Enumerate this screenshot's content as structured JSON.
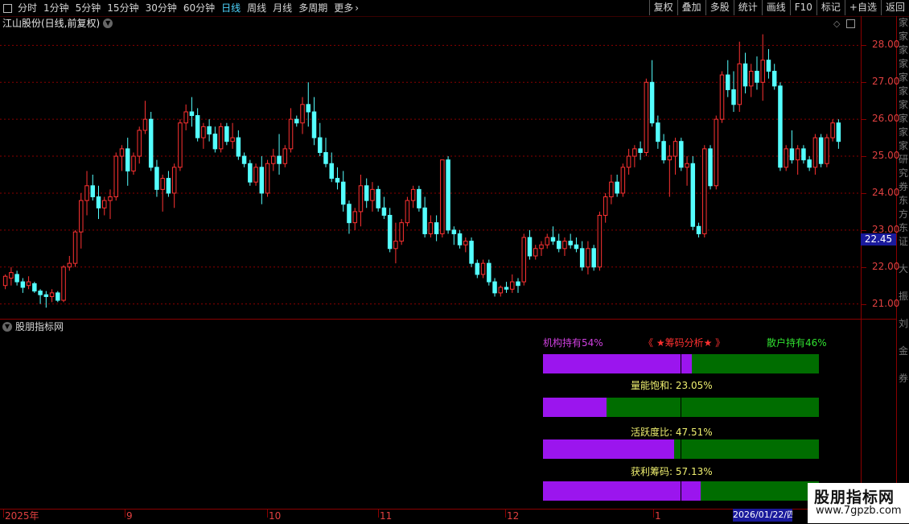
{
  "toolbar": {
    "period_tabs": [
      "分时",
      "1分钟",
      "5分钟",
      "15分钟",
      "30分钟",
      "60分钟",
      "日线",
      "周线",
      "月线",
      "多周期",
      "更多"
    ],
    "active_tab": "日线",
    "right_buttons": [
      "复权",
      "叠加",
      "多股",
      "统计",
      "画线",
      "F10",
      "标记",
      "+自选",
      "返回"
    ]
  },
  "main_panel": {
    "title": "江山股份(日线,前复权)",
    "current_price_label": "22.45",
    "price_axis_labels": [
      "28.00",
      "27.00",
      "26.00",
      "25.00",
      "24.00",
      "23.00",
      "22.00",
      "21.00"
    ]
  },
  "sub_panel": {
    "title": "股朋指标网",
    "header_left": "机构持有54%",
    "header_center": "《 ★筹码分析★ 》",
    "header_right": "散户持有46%",
    "rows": [
      {
        "label": "",
        "fraction": 0.54
      },
      {
        "label": "量能饱和:  23.05%",
        "fraction": 0.2305
      },
      {
        "label": "活跃度比:  47.51%",
        "fraction": 0.4751
      },
      {
        "label": "获利筹码:  57.13%",
        "fraction": 0.5713
      }
    ]
  },
  "date_axis": {
    "labels": [
      "2025年",
      "9",
      "10",
      "11",
      "12",
      "1"
    ],
    "cursor_date": "2026/01/22/四"
  },
  "right_strip_text": "家家家家家家家家家家研究券东方东证 大 振 刘 金 券",
  "watermark": {
    "line1": "股朋指标网",
    "line2": "www.7gpzb.com"
  },
  "colors": {
    "up": "#ff3232",
    "down": "#54ffff",
    "grid": "#8a0000",
    "purple": "#9b15ee",
    "green": "#006d00"
  },
  "chart_data": {
    "type": "candlestick",
    "ylim": [
      20.6,
      28.4
    ],
    "ohlc": [
      [
        21.5,
        21.8,
        21.4,
        21.75
      ],
      [
        21.7,
        22.0,
        21.5,
        21.85
      ],
      [
        21.8,
        21.9,
        21.5,
        21.6
      ],
      [
        21.6,
        21.7,
        21.3,
        21.45
      ],
      [
        21.5,
        21.75,
        21.4,
        21.6
      ],
      [
        21.55,
        21.6,
        21.3,
        21.35
      ],
      [
        21.35,
        21.4,
        21.0,
        21.25
      ],
      [
        21.25,
        21.35,
        20.9,
        21.2
      ],
      [
        21.2,
        21.4,
        21.05,
        21.3
      ],
      [
        21.3,
        21.35,
        21.05,
        21.1
      ],
      [
        21.1,
        22.05,
        21.05,
        22.0
      ],
      [
        22.0,
        22.3,
        21.9,
        22.1
      ],
      [
        22.1,
        23.0,
        22.0,
        22.95
      ],
      [
        22.95,
        24.0,
        22.5,
        23.8
      ],
      [
        23.8,
        24.6,
        23.4,
        24.2
      ],
      [
        24.2,
        24.5,
        23.8,
        23.9
      ],
      [
        23.9,
        24.2,
        23.3,
        23.6
      ],
      [
        23.6,
        23.9,
        23.4,
        23.8
      ],
      [
        23.8,
        24.1,
        23.3,
        23.9
      ],
      [
        23.9,
        25.1,
        23.8,
        25.0
      ],
      [
        25.0,
        25.3,
        24.6,
        25.2
      ],
      [
        25.2,
        25.5,
        24.2,
        24.6
      ],
      [
        24.6,
        25.1,
        24.5,
        25.0
      ],
      [
        25.0,
        25.8,
        24.8,
        25.7
      ],
      [
        25.7,
        26.5,
        25.6,
        26.0
      ],
      [
        26.0,
        26.2,
        24.6,
        24.7
      ],
      [
        24.7,
        24.9,
        23.9,
        24.1
      ],
      [
        24.1,
        24.5,
        23.5,
        24.4
      ],
      [
        24.4,
        24.6,
        23.9,
        24.0
      ],
      [
        24.0,
        24.8,
        23.6,
        24.7
      ],
      [
        24.7,
        26.0,
        24.6,
        25.9
      ],
      [
        25.9,
        26.4,
        25.7,
        26.2
      ],
      [
        26.2,
        26.6,
        25.8,
        26.1
      ],
      [
        26.1,
        26.3,
        25.4,
        25.5
      ],
      [
        25.5,
        25.9,
        25.2,
        25.8
      ],
      [
        25.8,
        26.0,
        25.4,
        25.6
      ],
      [
        25.6,
        25.8,
        25.1,
        25.2
      ],
      [
        25.2,
        25.9,
        25.1,
        25.8
      ],
      [
        25.8,
        25.9,
        25.3,
        25.4
      ],
      [
        25.4,
        25.9,
        25.2,
        25.5
      ],
      [
        25.5,
        25.7,
        24.9,
        25.0
      ],
      [
        25.0,
        25.1,
        24.7,
        24.8
      ],
      [
        24.8,
        24.9,
        24.2,
        24.3
      ],
      [
        24.3,
        24.8,
        24.2,
        24.7
      ],
      [
        24.7,
        25.0,
        23.7,
        24.0
      ],
      [
        24.0,
        24.9,
        23.9,
        24.8
      ],
      [
        24.8,
        25.2,
        24.6,
        25.0
      ],
      [
        25.0,
        25.6,
        24.5,
        24.8
      ],
      [
        24.8,
        25.3,
        24.7,
        25.2
      ],
      [
        25.2,
        26.3,
        25.1,
        26.0
      ],
      [
        26.0,
        26.1,
        25.8,
        25.9
      ],
      [
        25.9,
        26.6,
        25.6,
        26.4
      ],
      [
        26.4,
        27.0,
        25.8,
        26.2
      ],
      [
        26.2,
        26.6,
        25.3,
        25.5
      ],
      [
        25.5,
        25.9,
        25.0,
        25.1
      ],
      [
        25.1,
        25.5,
        24.7,
        24.8
      ],
      [
        24.8,
        25.1,
        24.3,
        24.4
      ],
      [
        24.4,
        24.7,
        24.1,
        24.3
      ],
      [
        24.3,
        24.6,
        23.5,
        23.7
      ],
      [
        23.7,
        23.8,
        22.9,
        23.2
      ],
      [
        23.2,
        23.6,
        23.0,
        23.5
      ],
      [
        23.5,
        24.5,
        23.1,
        24.2
      ],
      [
        24.2,
        24.4,
        23.6,
        23.8
      ],
      [
        23.8,
        24.3,
        23.5,
        24.1
      ],
      [
        24.1,
        24.2,
        23.5,
        23.6
      ],
      [
        23.6,
        23.9,
        23.3,
        23.4
      ],
      [
        23.4,
        23.6,
        22.4,
        22.5
      ],
      [
        22.5,
        23.2,
        22.1,
        22.7
      ],
      [
        22.7,
        23.3,
        22.6,
        23.2
      ],
      [
        23.2,
        23.9,
        23.1,
        23.8
      ],
      [
        23.8,
        24.2,
        23.6,
        24.1
      ],
      [
        24.1,
        24.2,
        23.5,
        23.6
      ],
      [
        23.6,
        23.9,
        22.8,
        22.9
      ],
      [
        22.9,
        23.4,
        22.8,
        23.2
      ],
      [
        23.2,
        23.4,
        22.7,
        22.9
      ],
      [
        22.9,
        24.9,
        22.8,
        24.9
      ],
      [
        24.9,
        25.0,
        22.9,
        23.0
      ],
      [
        23.0,
        23.1,
        22.6,
        22.9
      ],
      [
        22.9,
        23.0,
        22.5,
        22.6
      ],
      [
        22.6,
        22.8,
        22.4,
        22.7
      ],
      [
        22.7,
        22.8,
        22.0,
        22.1
      ],
      [
        22.1,
        22.2,
        21.7,
        21.8
      ],
      [
        21.8,
        22.2,
        21.7,
        22.1
      ],
      [
        22.1,
        22.2,
        21.5,
        21.6
      ],
      [
        21.6,
        21.7,
        21.2,
        21.3
      ],
      [
        21.3,
        21.5,
        21.2,
        21.45
      ],
      [
        21.45,
        21.6,
        21.3,
        21.4
      ],
      [
        21.4,
        21.8,
        21.3,
        21.6
      ],
      [
        21.6,
        21.7,
        21.3,
        21.5
      ],
      [
        21.6,
        22.9,
        21.5,
        22.8
      ],
      [
        22.8,
        23.0,
        22.2,
        22.3
      ],
      [
        22.3,
        22.6,
        22.2,
        22.5
      ],
      [
        22.5,
        22.7,
        22.3,
        22.6
      ],
      [
        22.6,
        22.9,
        22.5,
        22.8
      ],
      [
        22.8,
        23.1,
        22.6,
        22.7
      ],
      [
        22.7,
        22.9,
        22.4,
        22.5
      ],
      [
        22.5,
        22.8,
        22.3,
        22.7
      ],
      [
        22.7,
        22.9,
        22.5,
        22.6
      ],
      [
        22.6,
        22.8,
        22.4,
        22.5
      ],
      [
        22.5,
        22.7,
        21.9,
        22.0
      ],
      [
        22.0,
        22.7,
        21.8,
        22.5
      ],
      [
        22.5,
        22.6,
        21.9,
        22.0
      ],
      [
        22.0,
        23.5,
        21.9,
        23.4
      ],
      [
        23.4,
        24.0,
        23.2,
        23.9
      ],
      [
        23.9,
        24.5,
        23.7,
        24.3
      ],
      [
        24.3,
        24.5,
        23.9,
        24.0
      ],
      [
        24.0,
        24.8,
        23.9,
        24.7
      ],
      [
        24.7,
        25.2,
        24.5,
        25.0
      ],
      [
        25.0,
        25.3,
        24.7,
        25.2
      ],
      [
        25.2,
        25.4,
        24.9,
        25.1
      ],
      [
        25.1,
        27.1,
        25.0,
        27.0
      ],
      [
        27.0,
        27.6,
        25.8,
        25.9
      ],
      [
        25.9,
        26.1,
        25.2,
        25.4
      ],
      [
        25.4,
        25.6,
        24.8,
        24.9
      ],
      [
        24.9,
        25.3,
        23.9,
        25.0
      ],
      [
        25.0,
        25.5,
        24.5,
        25.4
      ],
      [
        25.4,
        25.5,
        24.6,
        24.7
      ],
      [
        24.7,
        25.0,
        24.2,
        24.8
      ],
      [
        24.8,
        25.0,
        23.0,
        23.1
      ],
      [
        23.1,
        23.2,
        22.8,
        22.9
      ],
      [
        22.9,
        25.3,
        22.8,
        25.2
      ],
      [
        25.2,
        25.3,
        24.1,
        24.2
      ],
      [
        24.2,
        26.1,
        24.1,
        26.0
      ],
      [
        26.0,
        27.3,
        25.9,
        27.2
      ],
      [
        27.2,
        27.6,
        26.6,
        26.8
      ],
      [
        26.8,
        27.3,
        26.2,
        26.4
      ],
      [
        26.4,
        28.1,
        26.2,
        27.5
      ],
      [
        27.5,
        27.8,
        26.7,
        26.9
      ],
      [
        26.9,
        27.5,
        26.6,
        27.3
      ],
      [
        27.3,
        27.7,
        26.8,
        27.0
      ],
      [
        27.0,
        28.3,
        26.5,
        27.6
      ],
      [
        27.6,
        27.9,
        27.1,
        27.3
      ],
      [
        27.3,
        27.5,
        26.8,
        26.9
      ],
      [
        26.9,
        27.0,
        24.6,
        24.7
      ],
      [
        24.7,
        25.3,
        24.6,
        25.2
      ],
      [
        25.2,
        25.7,
        24.8,
        24.9
      ],
      [
        24.9,
        25.3,
        24.5,
        25.2
      ],
      [
        25.2,
        25.3,
        24.8,
        24.9
      ],
      [
        24.9,
        25.0,
        24.6,
        24.7
      ],
      [
        24.7,
        25.6,
        24.5,
        25.5
      ],
      [
        25.5,
        25.6,
        24.7,
        24.8
      ],
      [
        24.8,
        25.6,
        24.7,
        25.5
      ],
      [
        25.5,
        26.0,
        25.4,
        25.9
      ],
      [
        25.9,
        26.0,
        25.2,
        25.4
      ]
    ]
  }
}
